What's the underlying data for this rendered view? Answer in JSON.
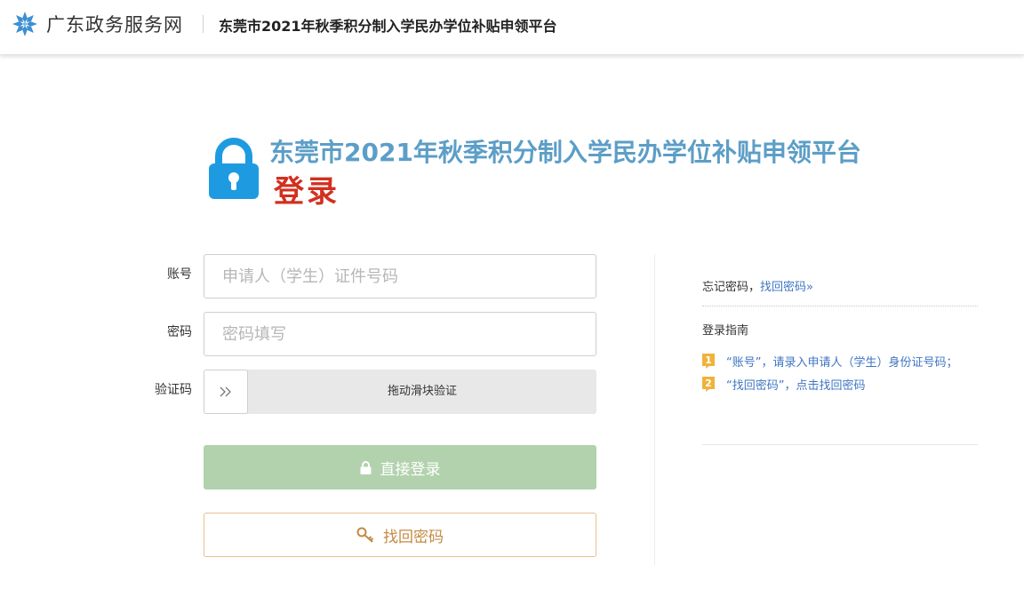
{
  "header": {
    "site_name": "广东政务服务网",
    "platform_title": "东莞市2021年秋季积分制入学民办学位补贴申领平台"
  },
  "hero": {
    "title": "东莞市2021年秋季积分制入学民办学位补贴申领平台",
    "subtitle": "登录"
  },
  "form": {
    "account_label": "账号",
    "account_placeholder": "申请人（学生）证件号码",
    "account_value": "",
    "password_label": "密码",
    "password_placeholder": "密码填写",
    "password_value": "",
    "captcha_label": "验证码",
    "slider_handle": "»",
    "slider_text": "拖动滑块验证",
    "login_button": "直接登录",
    "recover_button": "找回密码"
  },
  "side": {
    "forgot_prefix": "忘记密码，",
    "forgot_link": "找回密码»",
    "guide_title": "登录指南",
    "guides": [
      {
        "num": "1",
        "text": "“账号”，请录入申请人（学生）身份证号码；"
      },
      {
        "num": "2",
        "text": "“找回密码”，点击找回密码"
      }
    ]
  },
  "colors": {
    "accent_blue": "#5c9ec7",
    "login_red": "#d2301f",
    "login_button": "#b2d2ad",
    "recover_border": "#e6c08e",
    "link_blue": "#3f75c2",
    "badge_orange": "#f0b23a"
  },
  "icons": {
    "site_logo": "snowflake-logo-icon",
    "hero_lock": "padlock-icon",
    "login_btn": "lock-icon",
    "recover_btn": "key-icon",
    "slider": "double-chevron-right-icon"
  }
}
